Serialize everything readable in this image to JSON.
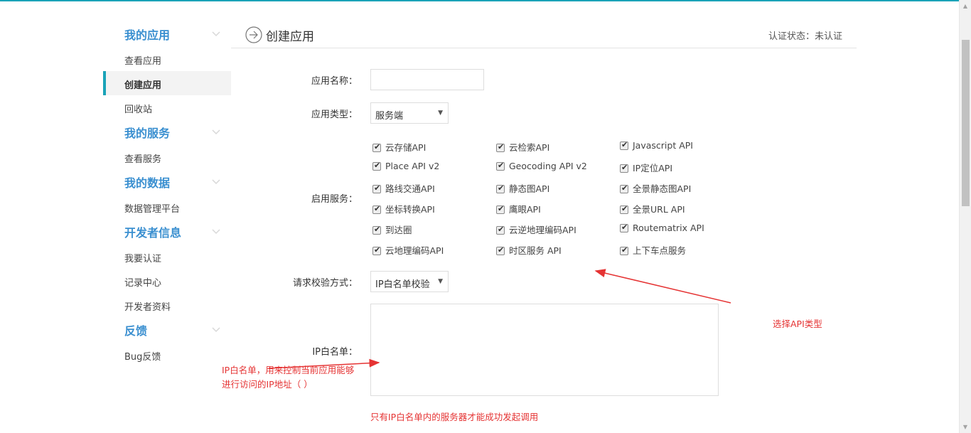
{
  "sidebar": {
    "groups": [
      {
        "title": "我的应用",
        "items": [
          "查看应用",
          "创建应用",
          "回收站"
        ]
      },
      {
        "title": "我的服务",
        "items": [
          "查看服务"
        ]
      },
      {
        "title": "我的数据",
        "items": [
          "数据管理平台"
        ]
      },
      {
        "title": "开发者信息",
        "items": [
          "我要认证",
          "记录中心",
          "开发者资料"
        ]
      },
      {
        "title": "反馈",
        "items": [
          "Bug反馈"
        ]
      }
    ],
    "active_item": "创建应用"
  },
  "header": {
    "title": "创建应用",
    "status": "认证状态：未认证",
    "arrow_icon": "circle-arrow-right-icon"
  },
  "form": {
    "app_name_label": "应用名称：",
    "app_name_value": "",
    "app_type_label": "应用类型：",
    "app_type_value": "服务端",
    "services_label": "启用服务：",
    "services": [
      {
        "label": "云存储API",
        "checked": true
      },
      {
        "label": "云检索API",
        "checked": true
      },
      {
        "label": "Javascript API",
        "checked": true
      },
      {
        "label": "Place API v2",
        "checked": true
      },
      {
        "label": "Geocoding API v2",
        "checked": true
      },
      {
        "label": "IP定位API",
        "checked": true
      },
      {
        "label": "路线交通API",
        "checked": true
      },
      {
        "label": "静态图API",
        "checked": true
      },
      {
        "label": "全景静态图API",
        "checked": true
      },
      {
        "label": "坐标转换API",
        "checked": true
      },
      {
        "label": "鹰眼API",
        "checked": true
      },
      {
        "label": "全景URL API",
        "checked": true
      },
      {
        "label": "到达圈",
        "checked": true
      },
      {
        "label": "云逆地理编码API",
        "checked": true
      },
      {
        "label": "Routematrix API",
        "checked": true
      },
      {
        "label": "云地理编码API",
        "checked": true
      },
      {
        "label": "时区服务 API",
        "checked": true
      },
      {
        "label": "上下车点服务",
        "checked": true
      }
    ],
    "verify_label": "请求校验方式：",
    "verify_value": "IP白名单校验",
    "whitelist_label": "IP白名单：",
    "whitelist_value": ""
  },
  "annotations": {
    "api_type": "选择API类型",
    "whitelist_line1": "IP白名单，用来控制当前应用能够",
    "whitelist_line2": "进行访问的IP地址（ ）",
    "whitelist_note": "只有IP白名单内的服务器才能成功发起调用",
    "color": "#e53333"
  },
  "colors": {
    "accent": "#1aa3b8",
    "group_title": "#3a8fd0"
  }
}
